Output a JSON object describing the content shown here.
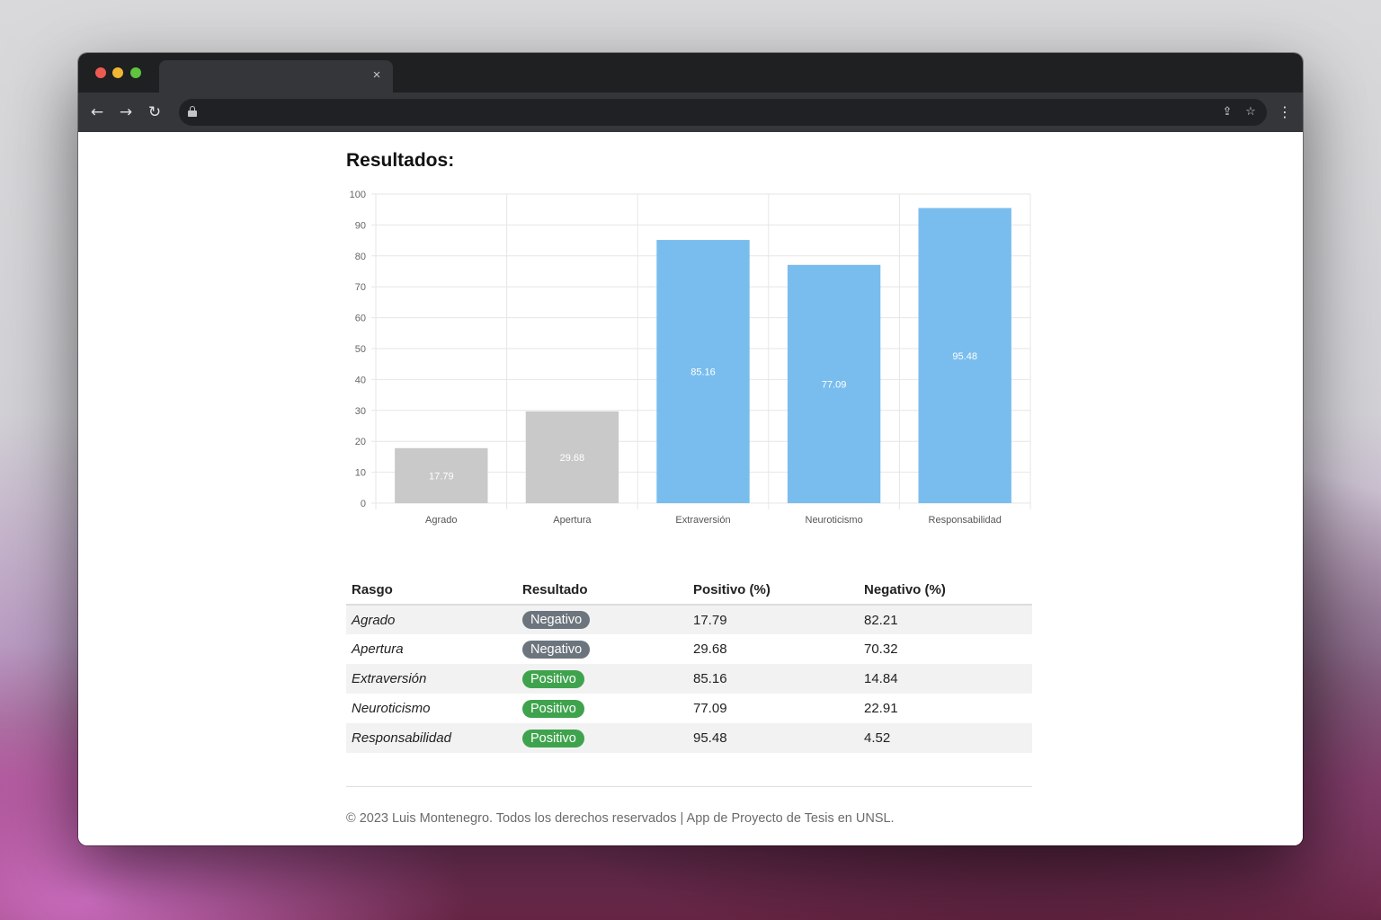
{
  "browser": {
    "tab_close": "×",
    "back_icon": "←",
    "forward_icon": "→",
    "reload_icon": "↻",
    "share_icon": "⇪",
    "star_icon": "☆",
    "menu_icon": "⋮"
  },
  "page": {
    "title": "Resultados:"
  },
  "chart_data": {
    "type": "bar",
    "title": "",
    "xlabel": "",
    "ylabel": "",
    "ylim": [
      0,
      100
    ],
    "yticks": [
      0,
      10,
      20,
      30,
      40,
      50,
      60,
      70,
      80,
      90,
      100
    ],
    "categories": [
      "Agrado",
      "Apertura",
      "Extraversión",
      "Neuroticismo",
      "Responsabilidad"
    ],
    "values": [
      17.79,
      29.68,
      85.16,
      77.09,
      95.48
    ],
    "data_labels": [
      "17.79",
      "29.68",
      "85.16",
      "77.09",
      "95.48"
    ],
    "bar_colors": [
      "#c9c9c9",
      "#c9c9c9",
      "#79bdee",
      "#79bdee",
      "#79bdee"
    ],
    "grid": true,
    "legend": "none"
  },
  "table": {
    "headers": [
      "Rasgo",
      "Resultado",
      "Positivo (%)",
      "Negativo (%)"
    ],
    "rows": [
      {
        "trait": "Agrado",
        "result": "Negativo",
        "positive": "17.79",
        "negative": "82.21"
      },
      {
        "trait": "Apertura",
        "result": "Negativo",
        "positive": "29.68",
        "negative": "70.32"
      },
      {
        "trait": "Extraversión",
        "result": "Positivo",
        "positive": "85.16",
        "negative": "14.84"
      },
      {
        "trait": "Neuroticismo",
        "result": "Positivo",
        "positive": "77.09",
        "negative": "22.91"
      },
      {
        "trait": "Responsabilidad",
        "result": "Positivo",
        "positive": "95.48",
        "negative": "4.52"
      }
    ]
  },
  "colors": {
    "negative_badge": "#6c757d",
    "positive_badge": "#3fa34d"
  },
  "footer": {
    "text": "© 2023 Luis Montenegro. Todos los derechos reservados | App de Proyecto de Tesis en UNSL."
  }
}
